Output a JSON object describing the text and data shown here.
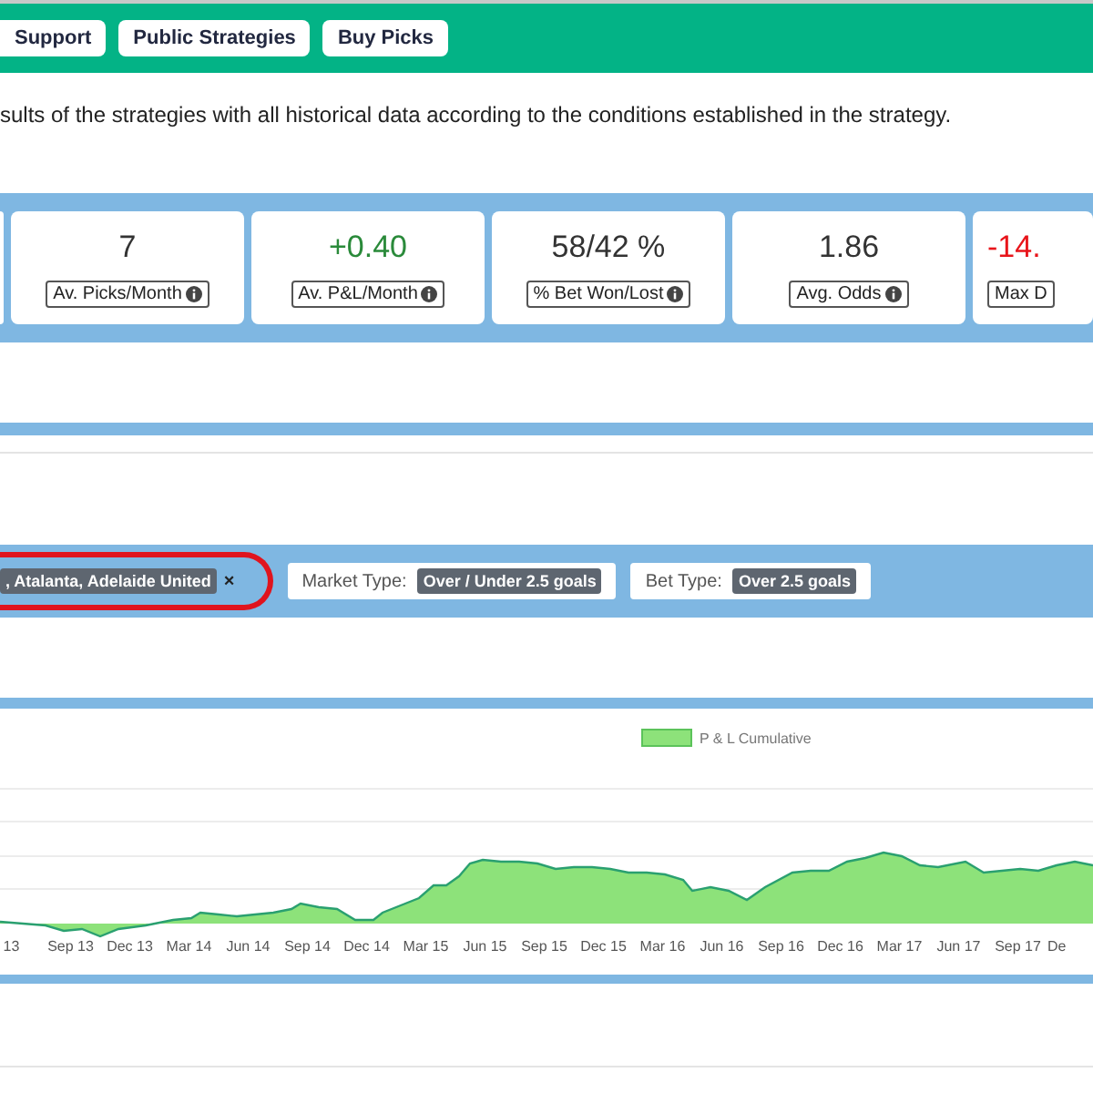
{
  "nav": {
    "buttons": [
      "Support",
      "Public Strategies",
      "Buy Picks"
    ]
  },
  "intro": "sults of the strategies with all historical data according to the conditions established in the strategy.",
  "stats": [
    {
      "value": "7",
      "label": "Av. Picks/Month",
      "color": "#333333"
    },
    {
      "value": "+0.40",
      "label": "Av. P&L/Month",
      "color": "#2a8a3a"
    },
    {
      "value": "58/42 %",
      "label": "% Bet Won/Lost",
      "color": "#333333"
    },
    {
      "value": "1.86",
      "label": "Avg. Odds",
      "color": "#333333"
    },
    {
      "value": "-14.",
      "label": "Max D",
      "color": "#e8141a"
    }
  ],
  "filters": [
    {
      "kind": "chip",
      "value": ", Atalanta, Adelaide United",
      "removable": true,
      "remove": "×",
      "highlighted": true
    },
    {
      "kind": "field",
      "label": "Market Type:",
      "value": "Over / Under 2.5 goals"
    },
    {
      "kind": "field",
      "label": "Bet Type:",
      "value": "Over 2.5 goals"
    }
  ],
  "chart": {
    "legend": "P & L Cumulative",
    "x_labels": [
      "13",
      "Sep 13",
      "Dec 13",
      "Mar 14",
      "Jun 14",
      "Sep 14",
      "Dec 14",
      "Mar 15",
      "Jun 15",
      "Sep 15",
      "Dec 15",
      "Mar 16",
      "Jun 16",
      "Sep 16",
      "Dec 16",
      "Mar 17",
      "Jun 17",
      "Sep 17",
      "De"
    ]
  }
}
